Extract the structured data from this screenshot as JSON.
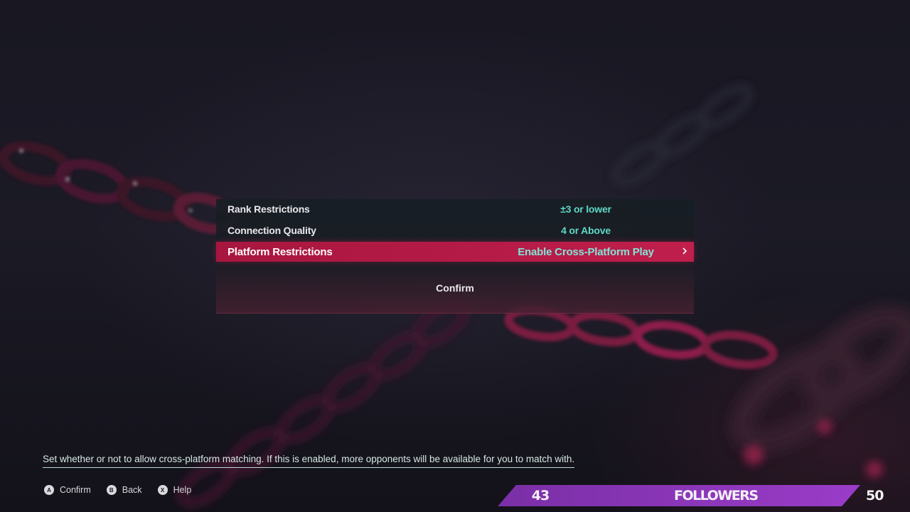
{
  "settings": {
    "rows": [
      {
        "label": "Rank Restrictions",
        "value": "±3 or lower"
      },
      {
        "label": "Connection Quality",
        "value": "4 or Above"
      },
      {
        "label": "Platform Restrictions",
        "value": "Enable Cross-Platform Play"
      }
    ],
    "selected_index": 2,
    "confirm_label": "Confirm"
  },
  "description": "Set whether or not to allow cross-platform matching. If this is enabled, more opponents will be available for you to match with.",
  "button_hints": [
    {
      "glyph": "A",
      "label": "Confirm"
    },
    {
      "glyph": "B",
      "label": "Back"
    },
    {
      "glyph": "X",
      "label": "Help"
    }
  ],
  "followers": {
    "current": "43",
    "label": "FOLLOWERS",
    "target": "50",
    "bar_color": "#8a35b8"
  },
  "colors": {
    "highlight": "#b51b47",
    "value_text": "#5fd8c5",
    "background": "#15141d"
  }
}
